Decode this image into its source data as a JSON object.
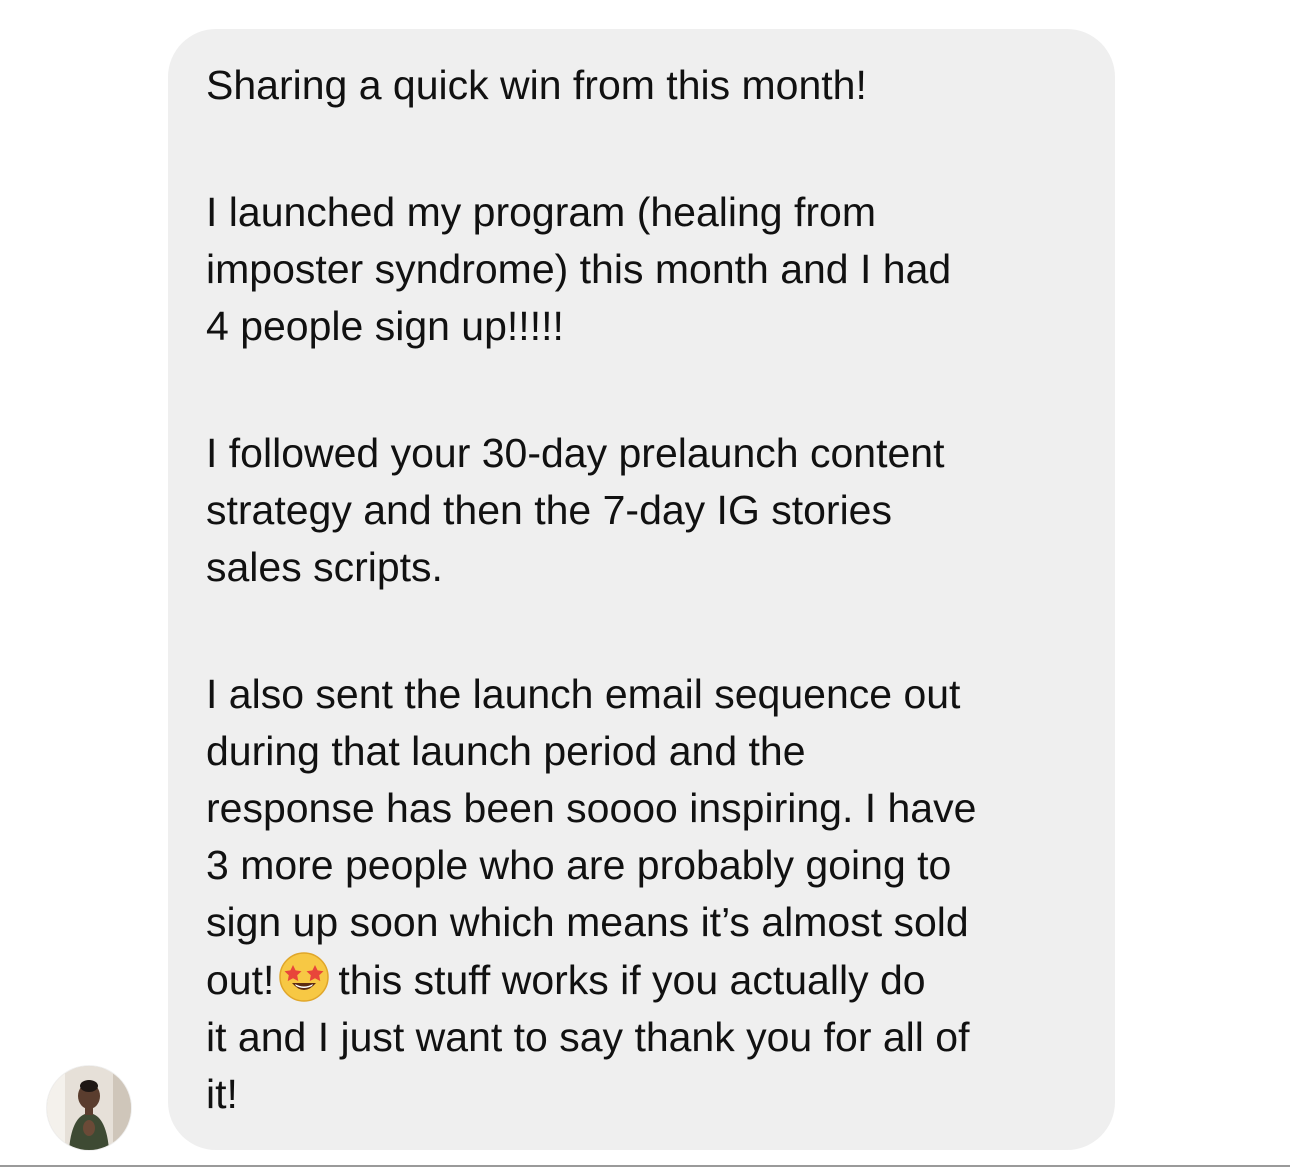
{
  "message": {
    "paragraphs": [
      "Sharing a quick win from this month!",
      "I launched my program (healing from\nimposter syndrome) this month and I had\n4 people sign up!!!!!",
      "I followed your 30-day prelaunch content\nstrategy and then the 7-day IG stories\nsales scripts."
    ],
    "last_paragraph_before_emoji": "I also sent the launch email sequence out\nduring that launch period and the\nresponse has been soooo inspiring. I have\n3 more people who are probably going to\nsign up soon which means it’s almost sold\nout!",
    "last_paragraph_after_emoji": "this stuff works if you actually do\nit and I just want to say thank you for all of\nit!",
    "emoji": "star-struck-emoji"
  },
  "colors": {
    "bubble": "#efefef",
    "text": "#111111",
    "background": "#ffffff"
  }
}
